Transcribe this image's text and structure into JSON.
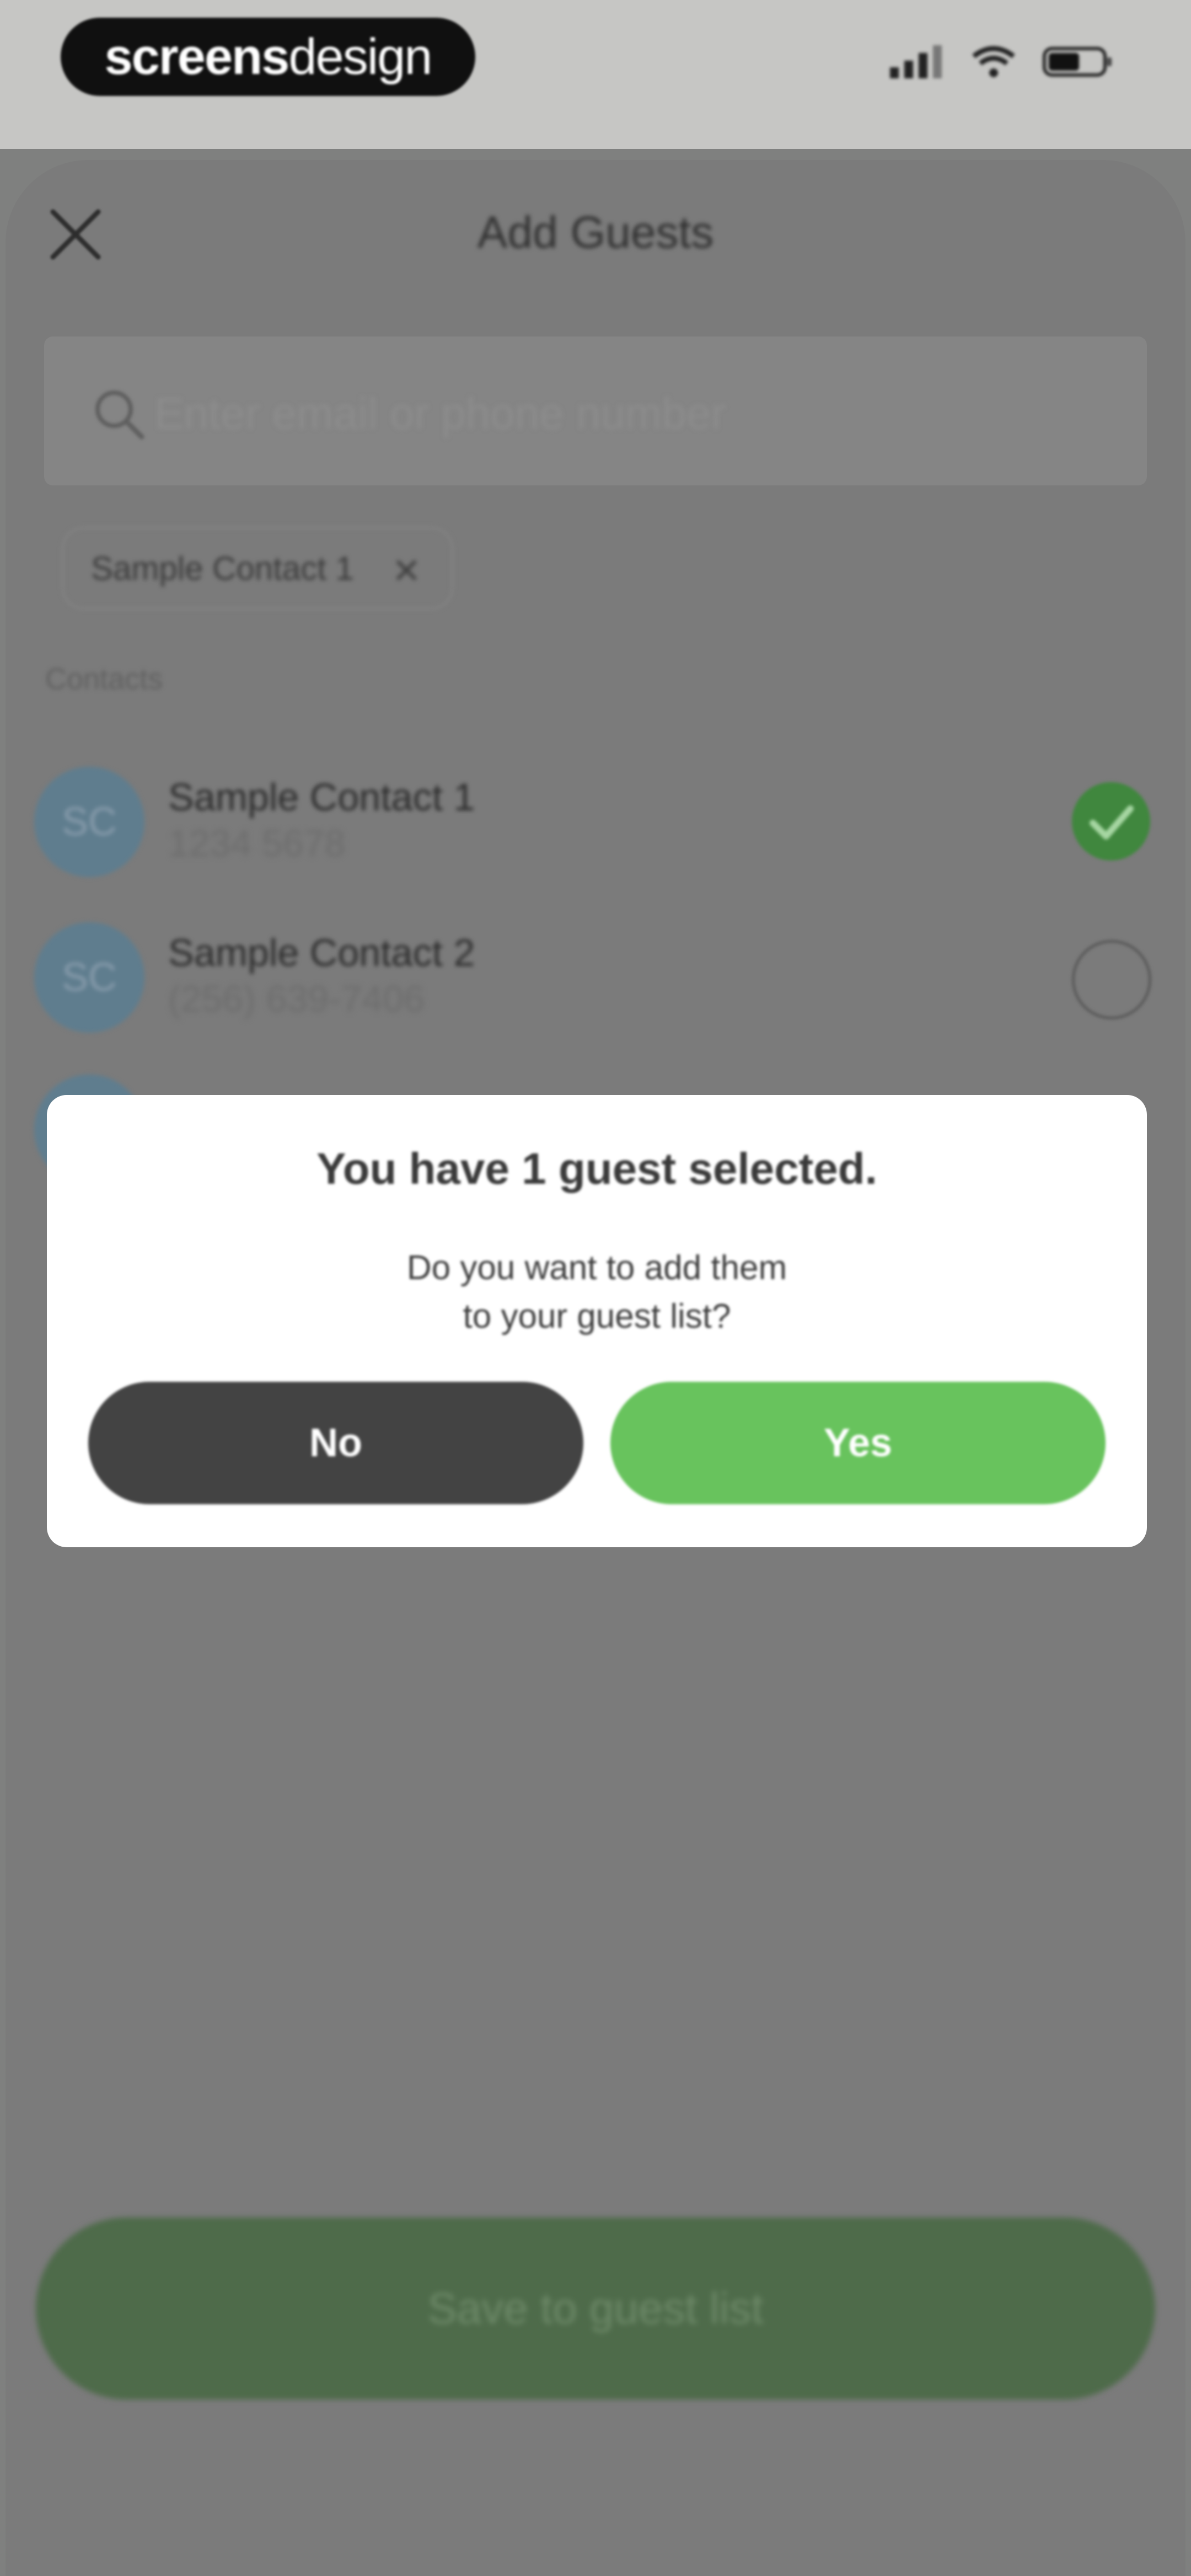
{
  "status_bar": {
    "brand_part1": "screens",
    "brand_part2": "design",
    "icons": [
      "signal-icon",
      "wifi-icon",
      "battery-icon"
    ]
  },
  "header": {
    "title": "Add Guests",
    "close_icon": "close-icon"
  },
  "search": {
    "placeholder": "Enter email or phone number",
    "icon": "search-icon"
  },
  "selected_chips": [
    {
      "label": "Sample Contact 1"
    }
  ],
  "contacts_section": {
    "label": "Contacts",
    "items": [
      {
        "initials": "SC",
        "name": "Sample Contact 1",
        "phone": "1234 5678",
        "selected": true
      },
      {
        "initials": "SC",
        "name": "Sample Contact 2",
        "phone": "(256) 639-7406",
        "selected": false
      }
    ]
  },
  "dialog": {
    "title": "You have 1 guest selected.",
    "message_line1": "Do you want to add them",
    "message_line2": "to your guest list?",
    "no_label": "No",
    "yes_label": "Yes"
  },
  "footer": {
    "save_label": "Save to guest list"
  },
  "colors": {
    "accent_green": "#68c35d",
    "dark_button": "#434343",
    "overlay": "#7f807f",
    "avatar": "#5f7d8e"
  }
}
